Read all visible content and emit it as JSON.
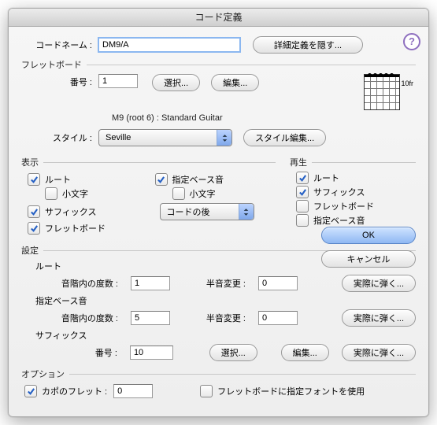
{
  "title": "コード定義",
  "help": "?",
  "codeName": {
    "label": "コードネーム :",
    "value": "DM9/A"
  },
  "hideAdvanced": "詳細定義を隠す...",
  "fretboard": {
    "title": "フレットボード",
    "numLabel": "番号 :",
    "numValue": "1",
    "selectBtn": "選択...",
    "editBtn": "編集...",
    "badge": "10fr",
    "info": "M9 (root 6) :  Standard Guitar"
  },
  "style": {
    "label": "スタイル :",
    "value": "Seville",
    "editBtn": "スタイル編集..."
  },
  "display": {
    "title": "表示",
    "root": "ルート",
    "lowercase": "小文字",
    "specBass": "指定ベース音",
    "lowercase2": "小文字",
    "suffix": "サフィックス",
    "afterChord": "コードの後",
    "fretboardChk": "フレットボード"
  },
  "play": {
    "title": "再生",
    "root": "ルート",
    "suffix": "サフィックス",
    "fretboardChk": "フレットボード",
    "specBass": "指定ベース音"
  },
  "buttons": {
    "ok": "OK",
    "cancel": "キャンセル"
  },
  "settings": {
    "title": "設定",
    "root": "ルート",
    "degreeLabel": "音階内の度数 :",
    "halfLabel": "半音変更 :",
    "playBtn": "実際に弾く...",
    "rootDegree": "1",
    "rootHalf": "0",
    "bass": "指定ベース音",
    "bassDegree": "5",
    "bassHalf": "0",
    "suffix": "サフィックス",
    "suffixNumLabel": "番号 :",
    "suffixNum": "10",
    "selectBtn": "選択...",
    "editBtn": "編集..."
  },
  "option": {
    "title": "オプション",
    "capoLabel": "カポのフレット :",
    "capoValue": "0",
    "useFont": "フレットボードに指定フォントを使用"
  }
}
